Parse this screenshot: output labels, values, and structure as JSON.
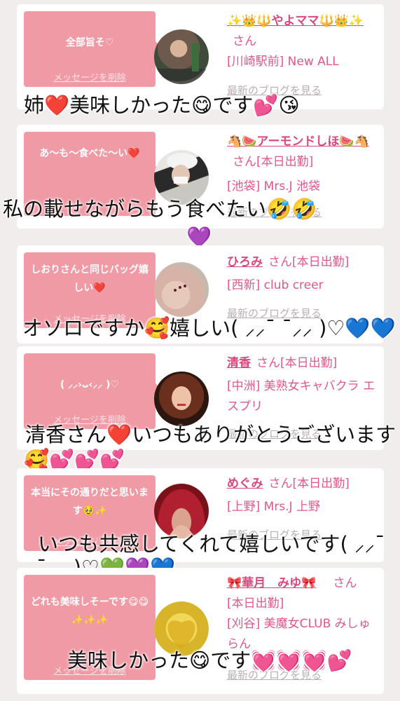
{
  "colors": {
    "background": "#f1eded",
    "bubble": "#f09aa5",
    "name": "#d9487e",
    "info": "#e0578a",
    "blog_link": "#b8b0b2"
  },
  "delete_label": "メッセージを削除",
  "blog_label": "最新のブログを見る",
  "items": [
    {
      "message": "全部旨そ♡",
      "name": "✨👑🔱やよママ🔱👑✨",
      "honorific": "さん",
      "location": "[川崎駅前] New ALL",
      "overlay": "姉❤️美味しかった😋です💕😘"
    },
    {
      "message": "あ〜も〜食べた〜い❤️",
      "name": "🐴🍉アーモンドしほ🍉🐴",
      "honorific": "さん[本日出勤]",
      "location": "[池袋] Mrs.J 池袋",
      "overlay": "私の載せながらもう食べたい🤣🤣",
      "overlay2": "💜"
    },
    {
      "message": "しおりさんと同じバッグ嬉しい❤️",
      "name": "ひろみ",
      "honorific": "さん[本日出勤]",
      "location": "[西新] club creer",
      "overlay": "オソロですか🥰嬉しい( ⸝⸝¯ ¯⸝⸝ )♡💙💙"
    },
    {
      "message": "( ⸝⸝›ᴗ‹⸝⸝ )♡",
      "name": "清香",
      "honorific": "さん[本日出勤]",
      "location": "[中洲] 美熟女キャバクラ エスプリ",
      "overlay": "清香さん❤️いつもありがとうございます",
      "overlay2": "🥰💕💕💕"
    },
    {
      "message": "本当にその通りだと思います🥹✨",
      "name": "めぐみ",
      "honorific": "さん[本日出勤]",
      "location": "[上野] Mrs.J 上野",
      "overlay": "いつも共感してくれて嬉しいです( ⸝⸝¯",
      "overlay2": "¯⸝⸝ )♡💚💜💙"
    },
    {
      "message": "どれも美味しそーです😋😋✨✨✨",
      "name": "🎀華月　みゆ🎀",
      "honorific": "さん",
      "status": "[本日出勤]",
      "location": "[刈谷] 美魔女CLUB みしゅらん",
      "overlay": "美味しかった😋です💓💓💓💕"
    }
  ]
}
